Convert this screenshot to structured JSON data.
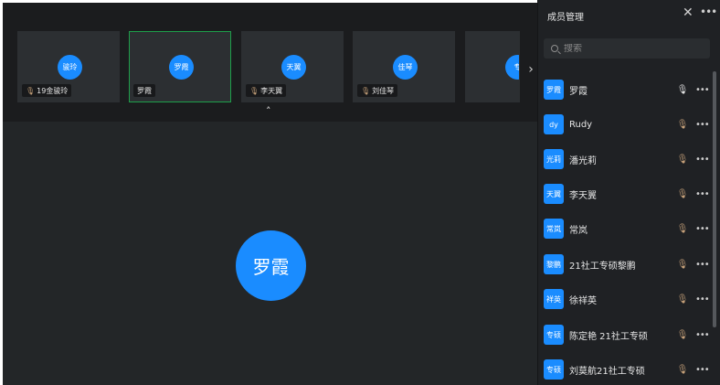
{
  "thumbnails": [
    {
      "avatar": "骏玲",
      "name": "19金骏玲",
      "mic_icon": "mic-muted-icon",
      "active": false
    },
    {
      "avatar": "罗霞",
      "name": "罗霞",
      "mic_icon": "",
      "active": true
    },
    {
      "avatar": "天翼",
      "name": "李天翼",
      "mic_icon": "mic-muted-icon",
      "active": false
    },
    {
      "avatar": "佳琴",
      "name": "刘佳琴",
      "mic_icon": "mic-muted-icon",
      "active": false
    },
    {
      "avatar": "专",
      "name": "",
      "mic_icon": "",
      "active": false
    }
  ],
  "main_speaker": {
    "avatar": "罗霞"
  },
  "member_panel": {
    "title": "成员管理",
    "search_placeholder": "搜索",
    "members": [
      {
        "avatar": "罗霞",
        "name": "罗霞",
        "mic": "on"
      },
      {
        "avatar": "dy",
        "name": "Rudy",
        "mic": "muted"
      },
      {
        "avatar": "光莉",
        "name": "潘光莉",
        "mic": "muted"
      },
      {
        "avatar": "天翼",
        "name": "李天翼",
        "mic": "muted"
      },
      {
        "avatar": "常岚",
        "name": "常岚",
        "mic": "muted"
      },
      {
        "avatar": "黎鹏",
        "name": "21社工专硕黎鹏",
        "mic": "muted"
      },
      {
        "avatar": "祥英",
        "name": "徐祥英",
        "mic": "muted"
      },
      {
        "avatar": "专硕",
        "name": "陈定艳 21社工专硕",
        "mic": "muted"
      },
      {
        "avatar": "专硕",
        "name": "刘莫航21社工专硕",
        "mic": "muted"
      }
    ]
  },
  "colors": {
    "accent": "#1a8cff",
    "active_border": "#1e9e4a",
    "muted_mic": "#c7a27a"
  }
}
